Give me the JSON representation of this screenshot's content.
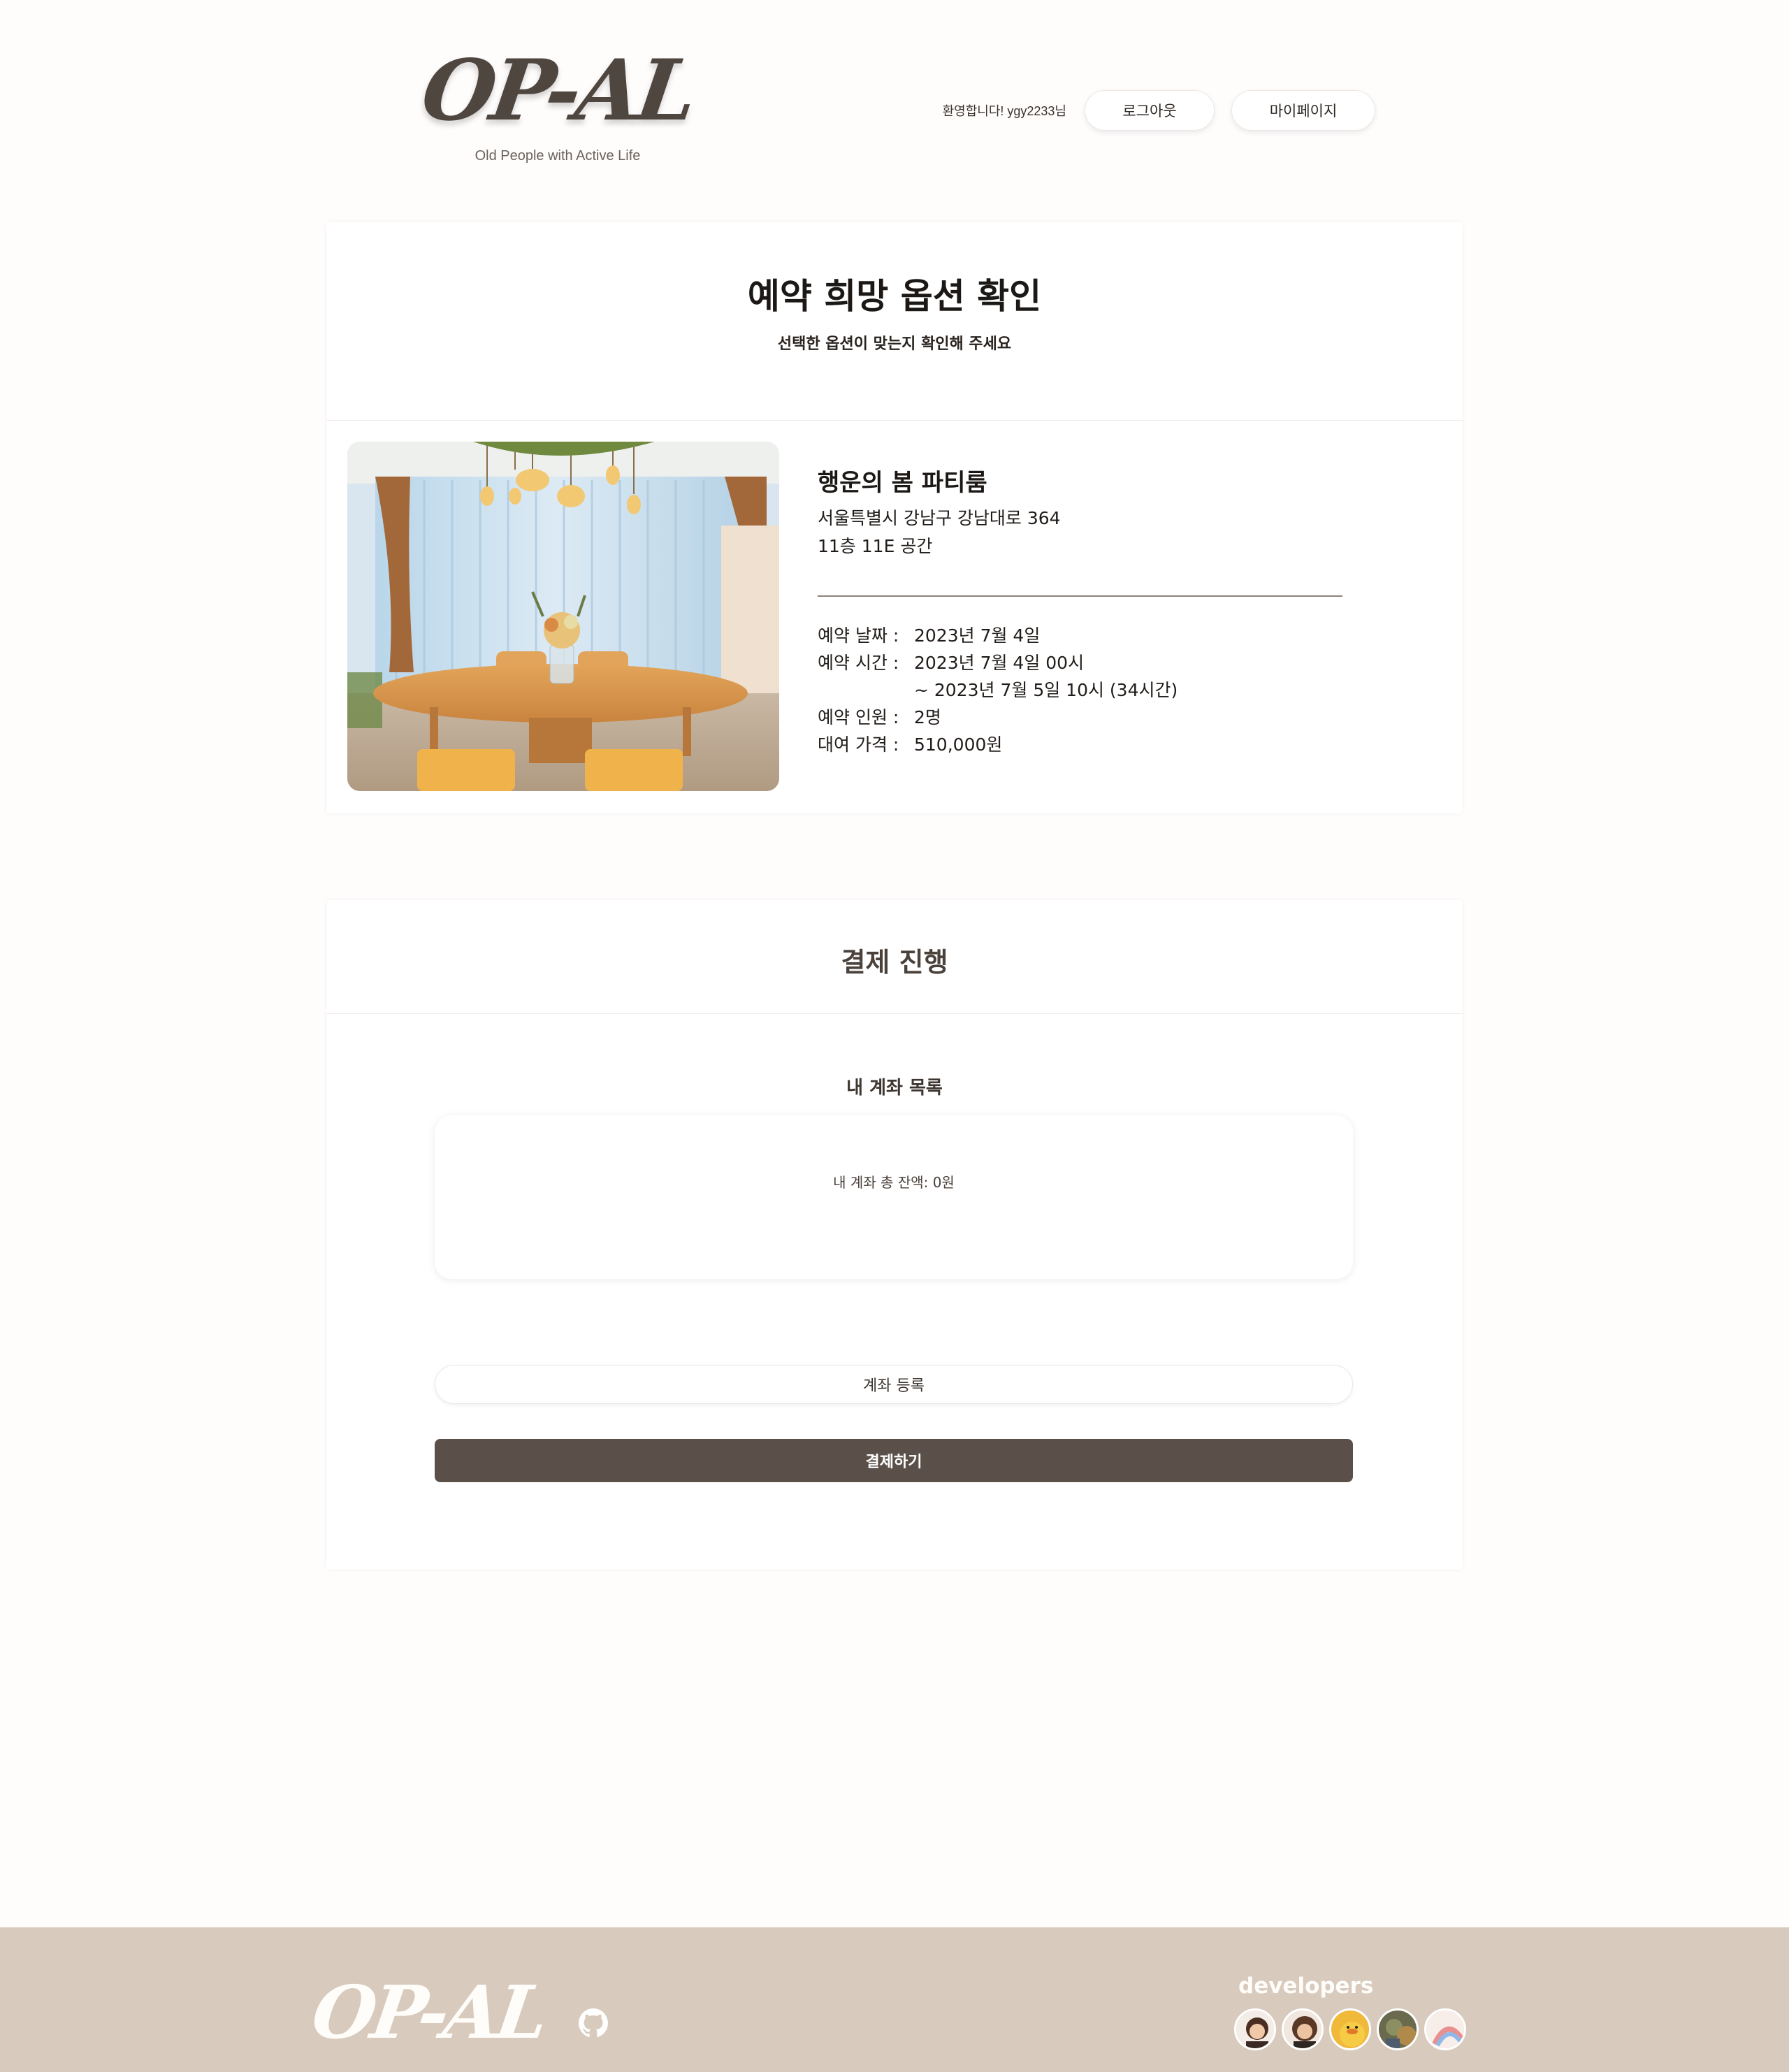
{
  "header": {
    "logo": "OP-AL",
    "tagline": "Old People with Active Life",
    "welcome": "환영합니다! ygy2233님",
    "logout_label": "로그아웃",
    "mypage_label": "마이페이지"
  },
  "reservation": {
    "title": "예약 희망 옵션 확인",
    "subtitle": "선택한 옵션이 맞는지 확인해 주세요",
    "room_name": "행운의 봄 파티룸",
    "address_line1": "서울특별시 강남구 강남대로 364",
    "address_line2": "11층 11E 공간",
    "date_label": "예약 날짜 :",
    "date_value": "2023년 7월 4일",
    "time_label": "예약 시간 :",
    "time_value": "2023년 7월 4일 00시",
    "time_value2": "~ 2023년 7월 5일 10시 (34시간)",
    "people_label": "예약 인원 :",
    "people_value": "2명",
    "price_label": "대여 가격 :",
    "price_value": "510,000원"
  },
  "payment": {
    "title": "결제 진행",
    "accounts_title": "내 계좌 목록",
    "balance_text": "내 계좌 총 잔액: 0원",
    "register_label": "계좌 등록",
    "pay_label": "결제하기"
  },
  "footer": {
    "logo": "OP-AL",
    "developers_label": "developers",
    "icons": [
      "github-icon"
    ]
  },
  "colors": {
    "brand_dark": "#5b5049",
    "footer_bg": "#d8cbbd",
    "page_bg": "#fffdfc"
  }
}
